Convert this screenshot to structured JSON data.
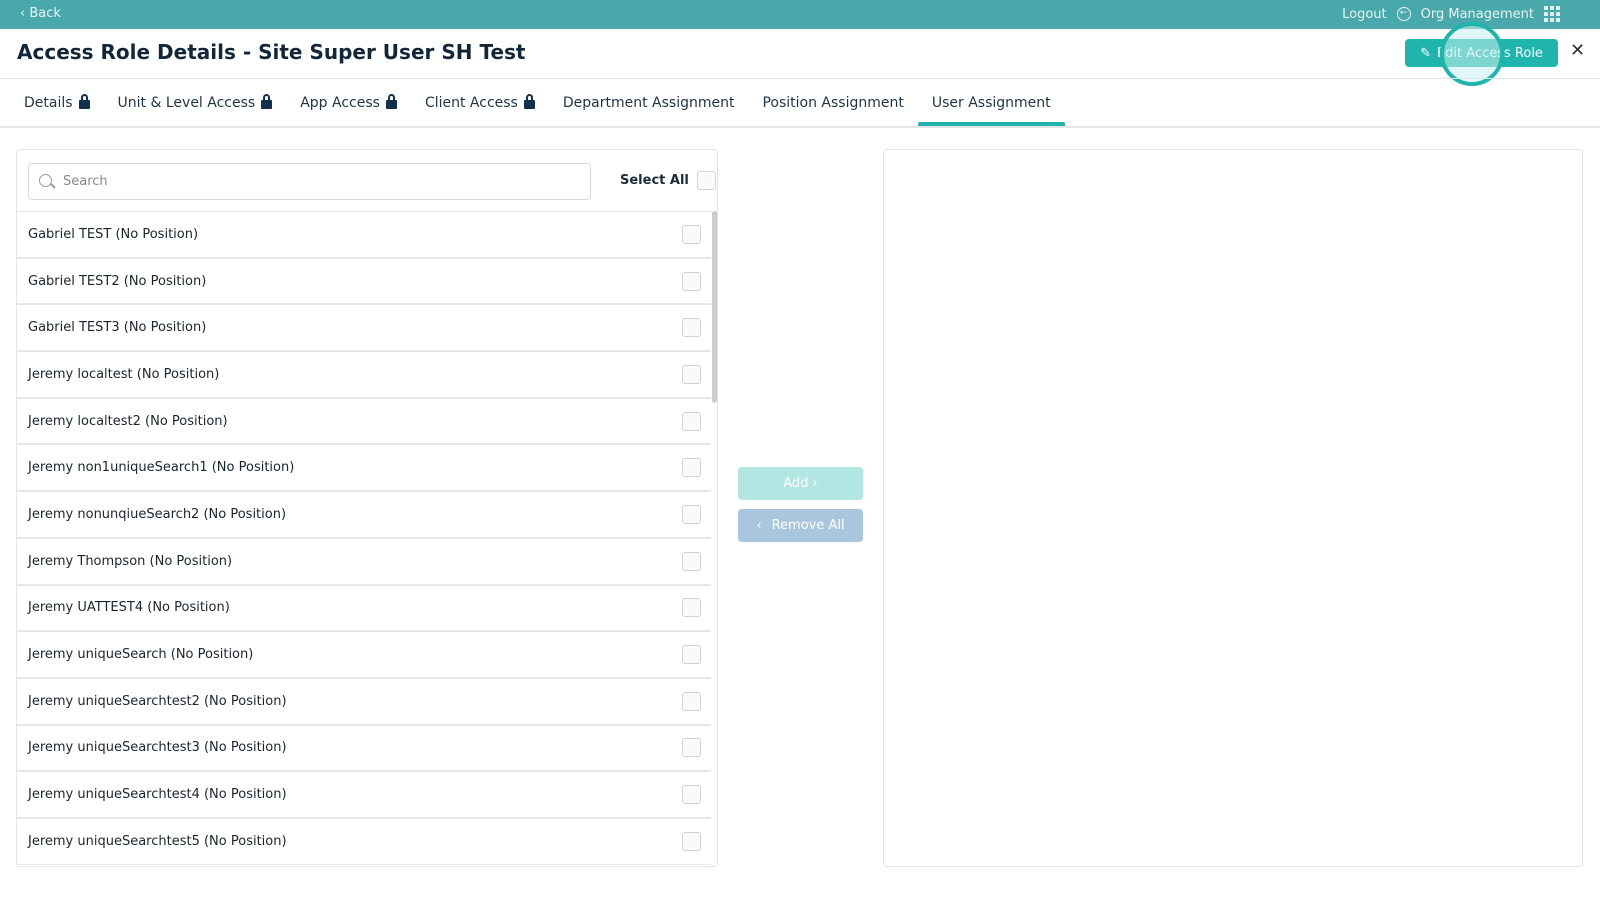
{
  "topbar": {
    "back": "‹ Back",
    "logout": "Logout",
    "org": "Org Management"
  },
  "header": {
    "title": "Access Role Details - Site Super User SH Test",
    "edit": "Edit Access Role",
    "close": "✕"
  },
  "tabs": [
    {
      "label": "Details",
      "locked": true
    },
    {
      "label": "Unit & Level Access",
      "locked": true
    },
    {
      "label": "App Access",
      "locked": true
    },
    {
      "label": "Client Access",
      "locked": true
    },
    {
      "label": "Department Assignment"
    },
    {
      "label": "Position Assignment"
    },
    {
      "label": "User Assignment",
      "active": true
    }
  ],
  "left": {
    "search_placeholder": "Search",
    "select_all": "Select All",
    "users": [
      "Gabriel TEST (No Position)",
      "Gabriel TEST2 (No Position)",
      "Gabriel TEST3 (No Position)",
      "Jeremy localtest (No Position)",
      "Jeremy localtest2 (No Position)",
      "Jeremy non1uniqueSearch1 (No Position)",
      "Jeremy nonunqiueSearch2 (No Position)",
      "Jeremy Thompson (No Position)",
      "Jeremy UATTEST4 (No Position)",
      "Jeremy uniqueSearch (No Position)",
      "Jeremy uniqueSearchtest2 (No Position)",
      "Jeremy uniqueSearchtest3 (No Position)",
      "Jeremy uniqueSearchtest4 (No Position)",
      "Jeremy uniqueSearchtest5 (No Position)"
    ]
  },
  "actions": {
    "add": "Add ›",
    "remove_all": "Remove All"
  }
}
